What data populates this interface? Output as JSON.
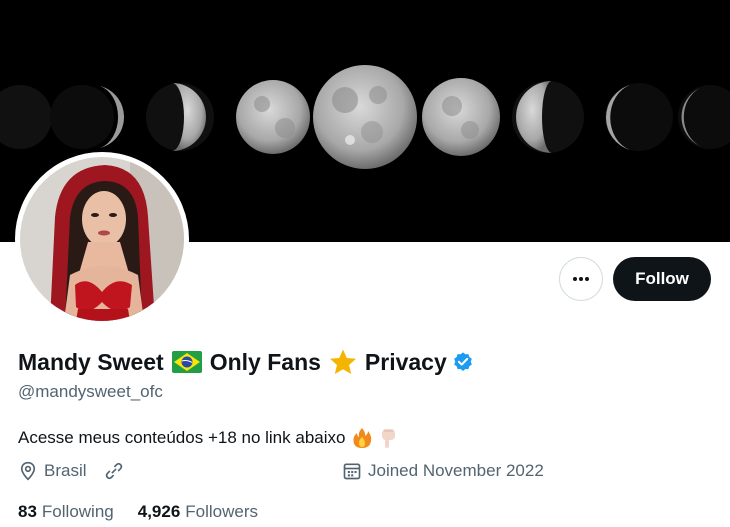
{
  "profile": {
    "display_name_part1": "Mandy Sweet",
    "display_name_part2": "Only Fans",
    "display_name_part3": "Privacy",
    "handle": "@mandysweet_ofc",
    "bio": "Acesse meus conteúdos +18 no link abaixo",
    "location": "Brasil",
    "joined": "Joined November 2022",
    "following_count": "83",
    "following_label": "Following",
    "followers_count": "4,926",
    "followers_label": "Followers"
  },
  "actions": {
    "follow_label": "Follow"
  },
  "icons": {
    "more": "more-horizontal-icon",
    "verified": "verified-badge-icon",
    "location": "location-pin-icon",
    "link": "link-icon",
    "calendar": "calendar-icon"
  },
  "colors": {
    "primary_text": "#0f1419",
    "secondary_text": "#536471",
    "verified": "#1d9bf0",
    "follow_bg": "#0f1419"
  }
}
